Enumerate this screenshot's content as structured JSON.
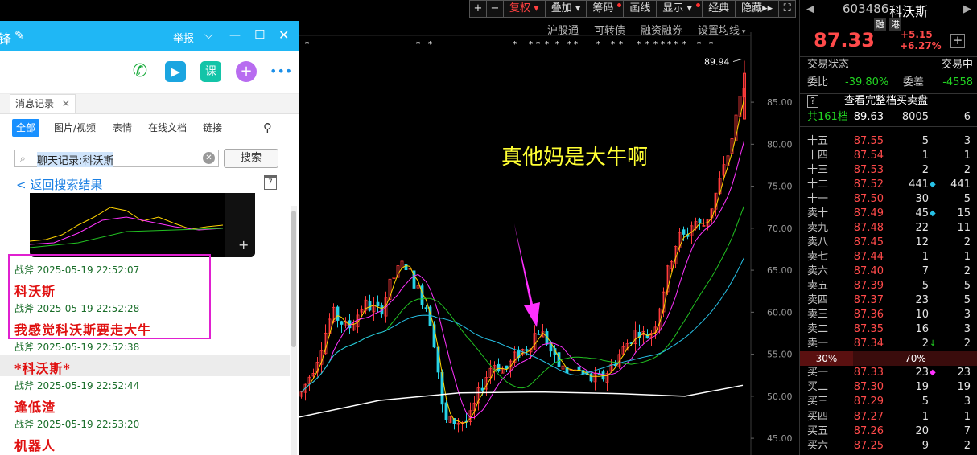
{
  "chart_toolbar": {
    "plus": "+",
    "minus": "−",
    "fuquan": "复权",
    "diejia": "叠加",
    "chouma": "筹码",
    "huaxian": "画线",
    "xianshi": "显示",
    "jingdian": "经典",
    "yincang": "隐藏"
  },
  "chart_subbar": [
    "沪股通",
    "可转债",
    "融资融券",
    "设置均线"
  ],
  "chart": {
    "peak_label": "89.94",
    "annotation": "真他妈是大牛啊",
    "y_ticks": [
      "85.00",
      "80.00",
      "75.00",
      "70.00",
      "65.00",
      "60.00",
      "55.00",
      "50.00",
      "45.00"
    ],
    "colors": {
      "up": "#ff3b3b",
      "down": "#27d3e6",
      "ma5": "#ffffff",
      "ma10": "#ffd400",
      "ma20": "#ff32ff",
      "ma30": "#22c322",
      "ma60": "#27c1e6",
      "ma120": "#ffffff",
      "arrow": "#ff30ff"
    }
  },
  "chart_data": {
    "type": "candlestick",
    "ylim": [
      43,
      91
    ],
    "y_ticks": [
      85,
      80,
      75,
      70,
      65,
      60,
      55,
      50,
      45
    ],
    "peak": 89.94,
    "last_close": 87.33
  },
  "quote": {
    "code": "603486",
    "name": "科沃斯",
    "tag_rong": "融",
    "tag_gang": "港",
    "price": "87.33",
    "change": "+5.15",
    "change_pct": "+6.27%",
    "status_label": "交易状态",
    "status_value": "交易中",
    "weibi_label": "委比",
    "weibi_value": "-39.80%",
    "weicha_label": "委差",
    "weicha_value": "-4558",
    "full_depth_q": "?",
    "full_depth": "查看完整档买卖盘",
    "levels_label": "共161档",
    "levels_price": "89.63",
    "levels_vol": "8005",
    "levels_chg": "6",
    "sell": [
      {
        "label": "十五",
        "price": "87.55",
        "vol": "5",
        "chg": "3",
        "mark": ""
      },
      {
        "label": "十四",
        "price": "87.54",
        "vol": "1",
        "chg": "1",
        "mark": ""
      },
      {
        "label": "十三",
        "price": "87.53",
        "vol": "2",
        "chg": "2",
        "mark": ""
      },
      {
        "label": "十二",
        "price": "87.52",
        "vol": "441",
        "chg": "441",
        "mark": "◆"
      },
      {
        "label": "十一",
        "price": "87.50",
        "vol": "30",
        "chg": "5",
        "mark": ""
      },
      {
        "label": "卖十",
        "price": "87.49",
        "vol": "45",
        "chg": "15",
        "mark": "◆"
      },
      {
        "label": "卖九",
        "price": "87.48",
        "vol": "22",
        "chg": "11",
        "mark": ""
      },
      {
        "label": "卖八",
        "price": "87.45",
        "vol": "12",
        "chg": "2",
        "mark": ""
      },
      {
        "label": "卖七",
        "price": "87.44",
        "vol": "1",
        "chg": "1",
        "mark": ""
      },
      {
        "label": "卖六",
        "price": "87.40",
        "vol": "7",
        "chg": "2",
        "mark": ""
      },
      {
        "label": "卖五",
        "price": "87.39",
        "vol": "5",
        "chg": "5",
        "mark": ""
      },
      {
        "label": "卖四",
        "price": "87.37",
        "vol": "23",
        "chg": "5",
        "mark": ""
      },
      {
        "label": "卖三",
        "price": "87.36",
        "vol": "10",
        "chg": "3",
        "mark": ""
      },
      {
        "label": "卖二",
        "price": "87.35",
        "vol": "16",
        "chg": "3",
        "mark": ""
      },
      {
        "label": "卖一",
        "price": "87.34",
        "vol": "2",
        "chg": "2",
        "mark": "↓"
      }
    ],
    "ratio_left": "30%",
    "ratio_right": "70%",
    "buy": [
      {
        "label": "买一",
        "price": "87.33",
        "vol": "23",
        "chg": "23",
        "mark": "◆"
      },
      {
        "label": "买二",
        "price": "87.30",
        "vol": "19",
        "chg": "19",
        "mark": ""
      },
      {
        "label": "买三",
        "price": "87.29",
        "vol": "5",
        "chg": "3",
        "mark": ""
      },
      {
        "label": "买四",
        "price": "87.27",
        "vol": "1",
        "chg": "1",
        "mark": ""
      },
      {
        "label": "买五",
        "price": "87.26",
        "vol": "20",
        "chg": "7",
        "mark": ""
      },
      {
        "label": "买六",
        "price": "87.25",
        "vol": "9",
        "chg": "2",
        "mark": ""
      }
    ]
  },
  "chat": {
    "title": "锋",
    "report": "举报",
    "tab_label": "消息记录",
    "filters": [
      "全部",
      "图片/视频",
      "表情",
      "在线文档",
      "链接"
    ],
    "search_value": "聊天记录:科沃斯",
    "search_button": "搜索",
    "back_link": "< 返回搜索结果",
    "calendar_day": "7",
    "messages": [
      {
        "sender": "战斧",
        "time": "2025-05-19 22:52:07",
        "text": "科沃斯"
      },
      {
        "sender": "战斧",
        "time": "2025-05-19 22:52:28",
        "text": "我感觉科沃斯要走大牛"
      },
      {
        "sender": "战斧",
        "time": "2025-05-19 22:52:38",
        "text": "*科沃斯*"
      },
      {
        "sender": "战斧",
        "time": "2025-05-19 22:52:44",
        "text": "逢低渣"
      },
      {
        "sender": "战斧",
        "time": "2025-05-19 22:53:20",
        "text": "机器人"
      }
    ]
  }
}
